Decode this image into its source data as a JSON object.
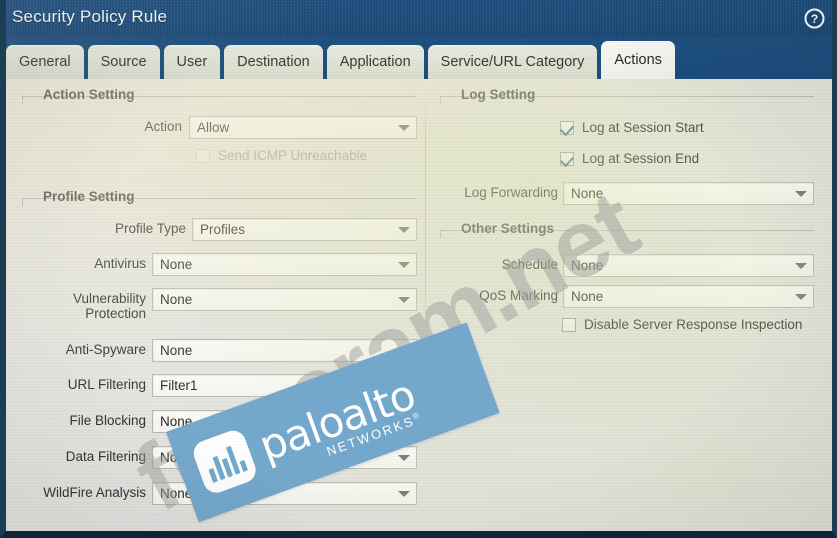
{
  "window": {
    "title": "Security Policy Rule",
    "help_icon": "help-circle-icon",
    "help_glyph": "?"
  },
  "tabs": [
    {
      "label": "General",
      "active": false
    },
    {
      "label": "Source",
      "active": false
    },
    {
      "label": "User",
      "active": false
    },
    {
      "label": "Destination",
      "active": false
    },
    {
      "label": "Application",
      "active": false
    },
    {
      "label": "Service/URL Category",
      "active": false
    },
    {
      "label": "Actions",
      "active": true
    }
  ],
  "left_column": {
    "action_setting": {
      "title": "Action Setting",
      "action": {
        "label": "Action",
        "value": "Allow",
        "caret_icon": "chevron-down-icon"
      },
      "send_icmp": {
        "label": "Send ICMP Unreachable",
        "checked": false,
        "disabled": true
      }
    },
    "profile_setting": {
      "title": "Profile Setting",
      "rows": [
        {
          "label": "Profile Type",
          "value": "Profiles"
        },
        {
          "label": "Antivirus",
          "value": "None"
        },
        {
          "label": "Vulnerability\nProtection",
          "value": "None"
        },
        {
          "label": "Anti-Spyware",
          "value": "None"
        },
        {
          "label": "URL Filtering",
          "value": "Filter1"
        },
        {
          "label": "File Blocking",
          "value": "None"
        },
        {
          "label": "Data Filtering",
          "value": "None"
        },
        {
          "label": "WildFire Analysis",
          "value": "None"
        }
      ]
    }
  },
  "right_column": {
    "log_setting": {
      "title": "Log Setting",
      "checkboxes": [
        {
          "label": "Log at Session Start",
          "checked": true
        },
        {
          "label": "Log at Session End",
          "checked": true
        }
      ],
      "log_forwarding": {
        "label": "Log Forwarding",
        "value": "None"
      }
    },
    "other_settings": {
      "title": "Other Settings",
      "rows": [
        {
          "label": "Schedule",
          "value": "None"
        },
        {
          "label": "QoS Marking",
          "value": "None"
        }
      ],
      "disable_inspection": {
        "label": "Disable Server Response Inspection",
        "checked": false
      }
    }
  },
  "watermarks": {
    "site_text": "freecram.net",
    "brand_name": "paloalto",
    "brand_sub": "NETWORKS",
    "brand_mark": "®",
    "banner_color": "#74a9cd"
  },
  "colors": {
    "titlebar": "#1d4f7f",
    "accent_check": "#2f6fa8",
    "panel_bg": "#e6e6e0"
  }
}
